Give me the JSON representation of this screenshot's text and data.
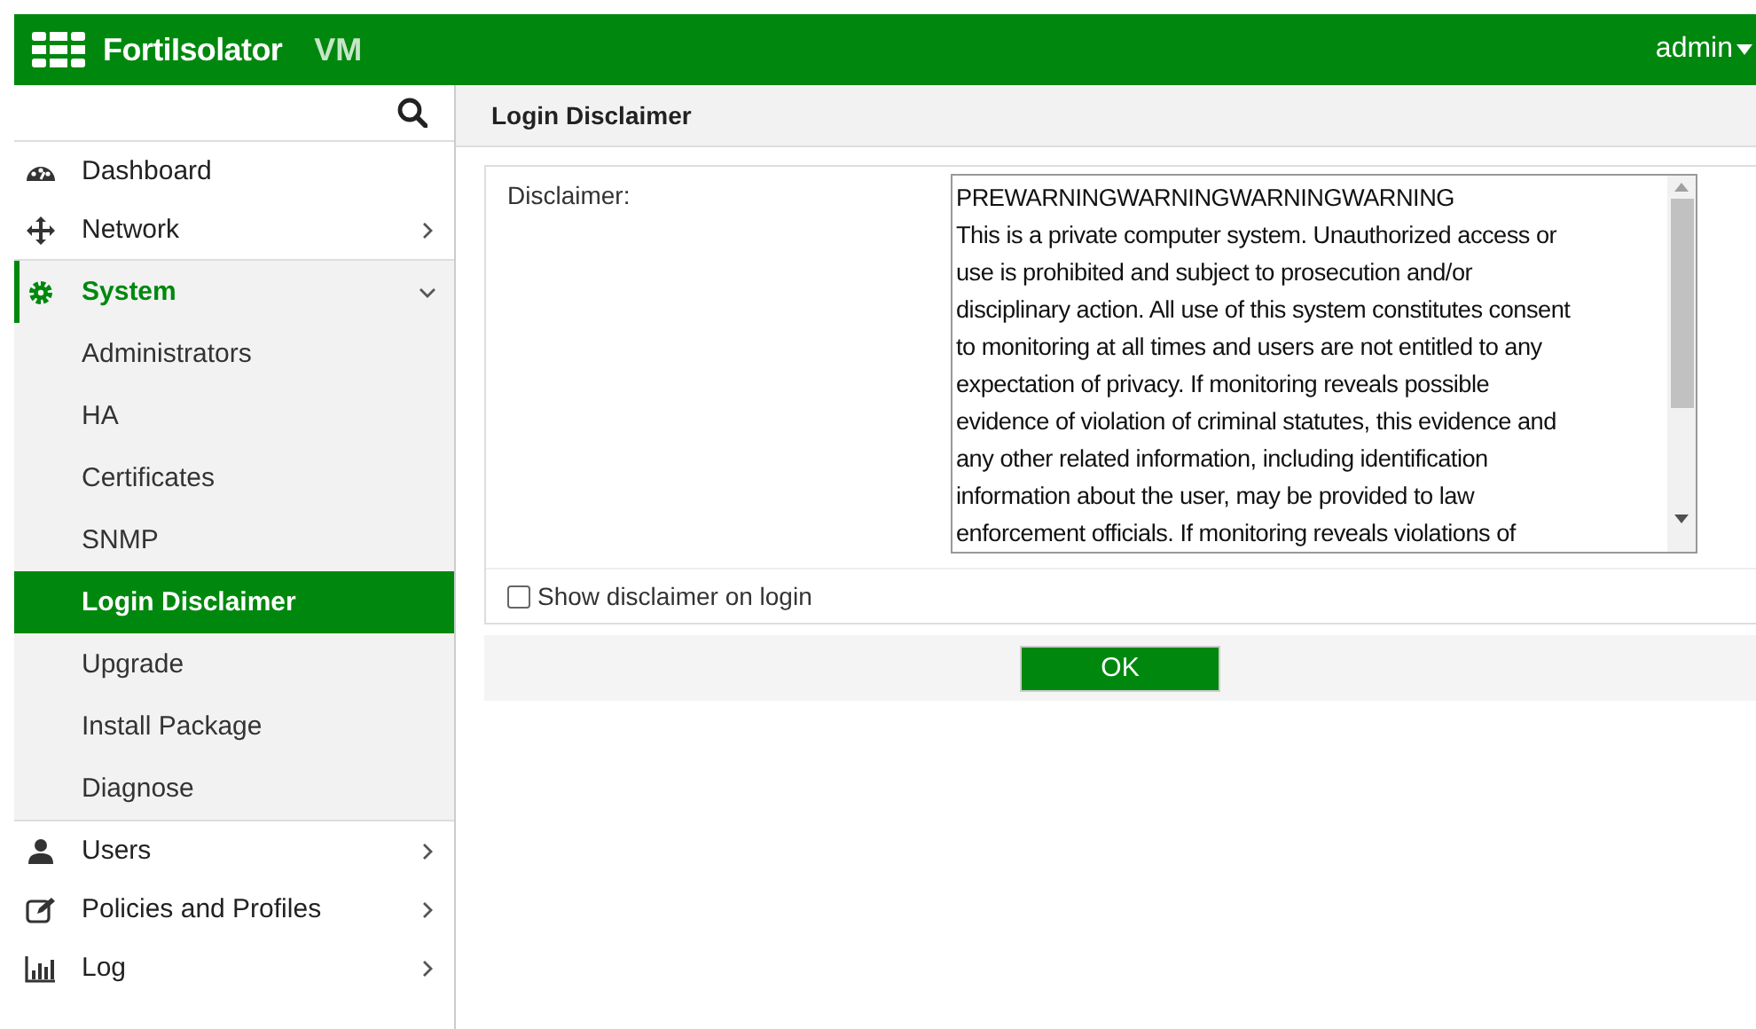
{
  "header": {
    "brand": "FortiIsolator",
    "edition": "VM",
    "user": "admin"
  },
  "sidebar": {
    "items": [
      {
        "label": "Dashboard",
        "selected": false
      },
      {
        "label": "Network",
        "selected": false,
        "expanded": false
      },
      {
        "label": "System",
        "selected": true,
        "expanded": true,
        "children": [
          {
            "label": "Administrators",
            "selected": false
          },
          {
            "label": "HA",
            "selected": false
          },
          {
            "label": "Certificates",
            "selected": false
          },
          {
            "label": "SNMP",
            "selected": false
          },
          {
            "label": "Login Disclaimer",
            "selected": true
          },
          {
            "label": "Upgrade",
            "selected": false
          },
          {
            "label": "Install Package",
            "selected": false
          },
          {
            "label": "Diagnose",
            "selected": false
          }
        ]
      },
      {
        "label": "Users",
        "selected": false,
        "expanded": false
      },
      {
        "label": "Policies and Profiles",
        "selected": false,
        "expanded": false
      },
      {
        "label": "Log",
        "selected": false,
        "expanded": false
      }
    ]
  },
  "page": {
    "title": "Login Disclaimer",
    "disclaimer_label": "Disclaimer:",
    "disclaimer_lines": [
      "PREWARNINGWARNINGWARNINGWARNING",
      "This is a private computer system. Unauthorized access or",
      "use is prohibited and subject to prosecution and/or",
      "disciplinary action. All use of this system constitutes consent",
      "to monitoring at all times and users are not entitled to any",
      "expectation of privacy. If monitoring reveals possible",
      "evidence of violation of criminal statutes, this evidence and",
      "any other related information, including identification",
      "information about the user, may be provided to law",
      "enforcement officials. If monitoring reveals violations of"
    ],
    "show_on_login": {
      "label": "Show disclaimer on login",
      "checked": false
    },
    "ok_button": "OK"
  }
}
